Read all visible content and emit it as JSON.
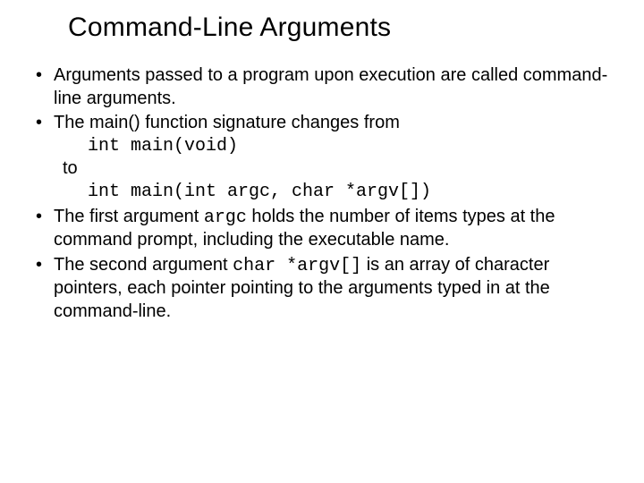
{
  "title": "Command-Line Arguments",
  "b1": {
    "line": "Arguments passed to a program upon execution are called command-line arguments."
  },
  "b2": {
    "lead": "The main() function signature changes from",
    "code1": "int main(void)",
    "to": "to",
    "code2": "int main(int argc, char *argv[])"
  },
  "b3": {
    "p1": "The first argument ",
    "code": "argc",
    "p2": " holds the number of items types at the command prompt, including the executable name."
  },
  "b4": {
    "p1": "The second argument ",
    "code": "char *argv[]",
    "p2": " is an array of character pointers, each pointer pointing to the arguments typed in at the command-line."
  }
}
